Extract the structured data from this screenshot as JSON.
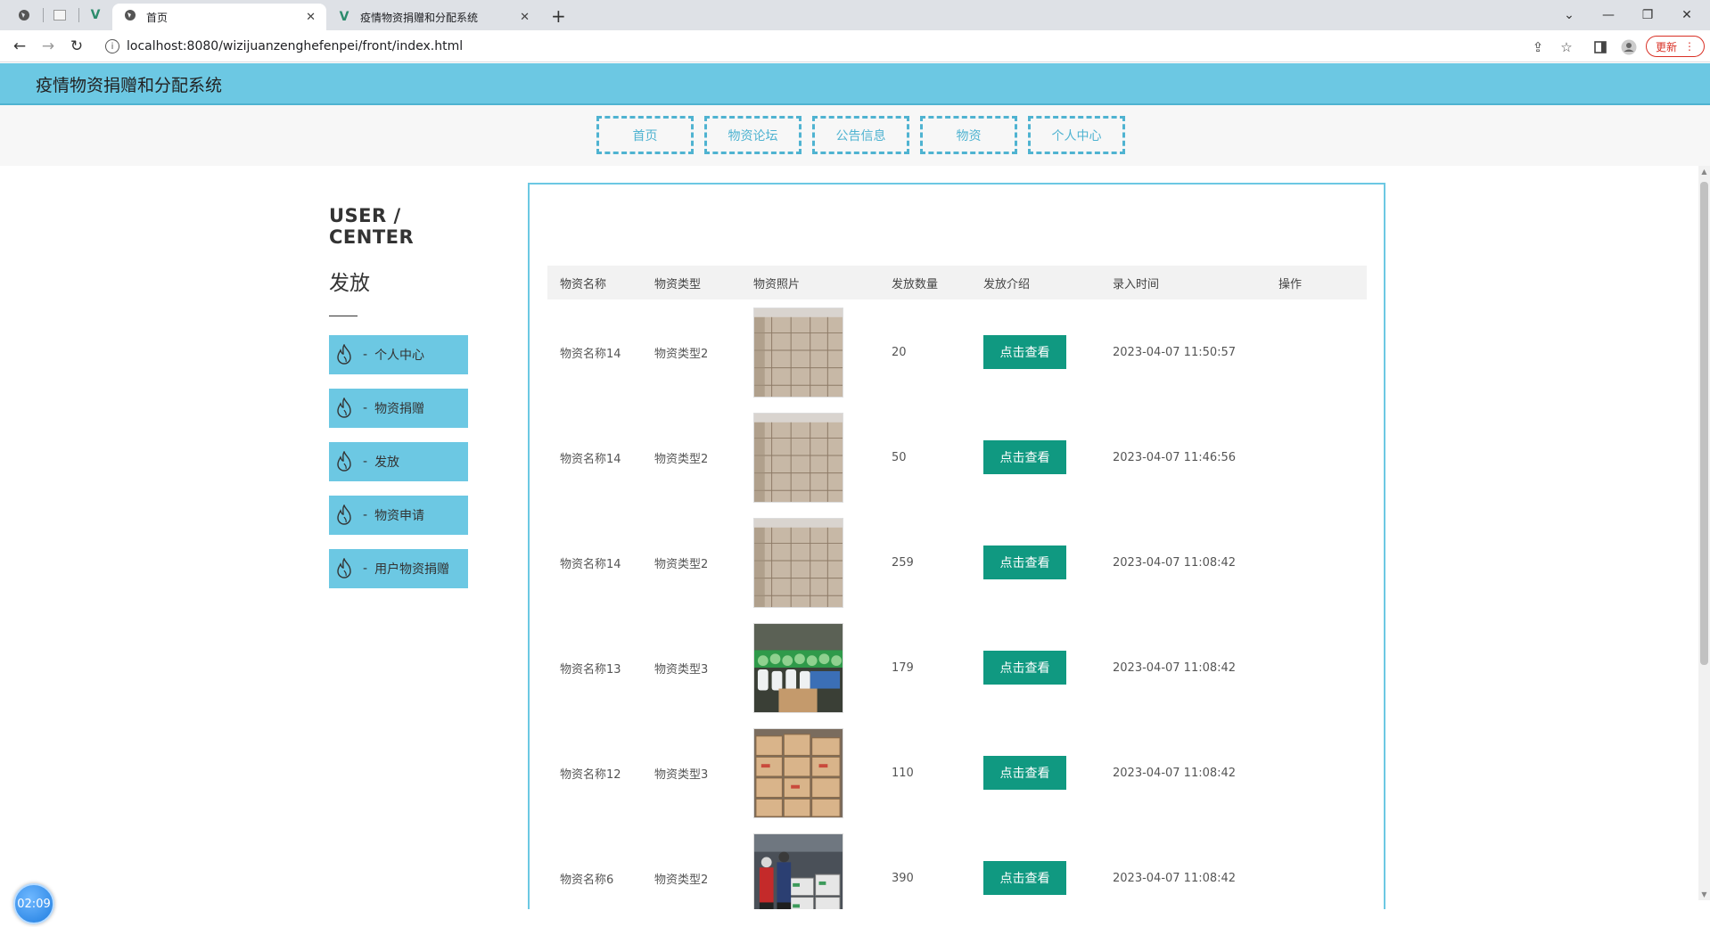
{
  "browser": {
    "tabs": [
      {
        "title": "首页",
        "active": true
      },
      {
        "title": "疫情物资捐赠和分配系统",
        "active": false
      }
    ],
    "url": "localhost:8080/wizijuanzenghefenpei/front/index.html",
    "update_label": "更新"
  },
  "site": {
    "title": "疫情物资捐赠和分配系统",
    "nav": [
      "首页",
      "物资论坛",
      "公告信息",
      "物资",
      "个人中心"
    ]
  },
  "sidebar": {
    "heading_en": "USER / CENTER",
    "heading_cn": "发放",
    "separator": "-",
    "items": [
      {
        "label": "个人中心"
      },
      {
        "label": "物资捐赠"
      },
      {
        "label": "发放"
      },
      {
        "label": "物资申请"
      },
      {
        "label": "用户物资捐赠"
      }
    ]
  },
  "table": {
    "headers": [
      "物资名称",
      "物资类型",
      "物资照片",
      "发放数量",
      "发放介绍",
      "录入时间",
      "操作"
    ],
    "view_label": "点击查看",
    "rows": [
      {
        "name": "物资名称14",
        "type": "物资类型2",
        "photo": "stacked-boxes",
        "quantity": "20",
        "time": "2023-04-07 11:50:57"
      },
      {
        "name": "物资名称14",
        "type": "物资类型2",
        "photo": "stacked-boxes",
        "quantity": "50",
        "time": "2023-04-07 11:46:56"
      },
      {
        "name": "物资名称14",
        "type": "物资类型2",
        "photo": "stacked-boxes",
        "quantity": "259",
        "time": "2023-04-07 11:08:42"
      },
      {
        "name": "物资名称13",
        "type": "物资类型3",
        "photo": "bottles",
        "quantity": "179",
        "time": "2023-04-07 11:08:42"
      },
      {
        "name": "物资名称12",
        "type": "物资类型3",
        "photo": "warehouse-boxes",
        "quantity": "110",
        "time": "2023-04-07 11:08:42"
      },
      {
        "name": "物资名称6",
        "type": "物资类型2",
        "photo": "workers-boxes",
        "quantity": "390",
        "time": "2023-04-07 11:08:42"
      }
    ]
  },
  "timer": "02:09"
}
